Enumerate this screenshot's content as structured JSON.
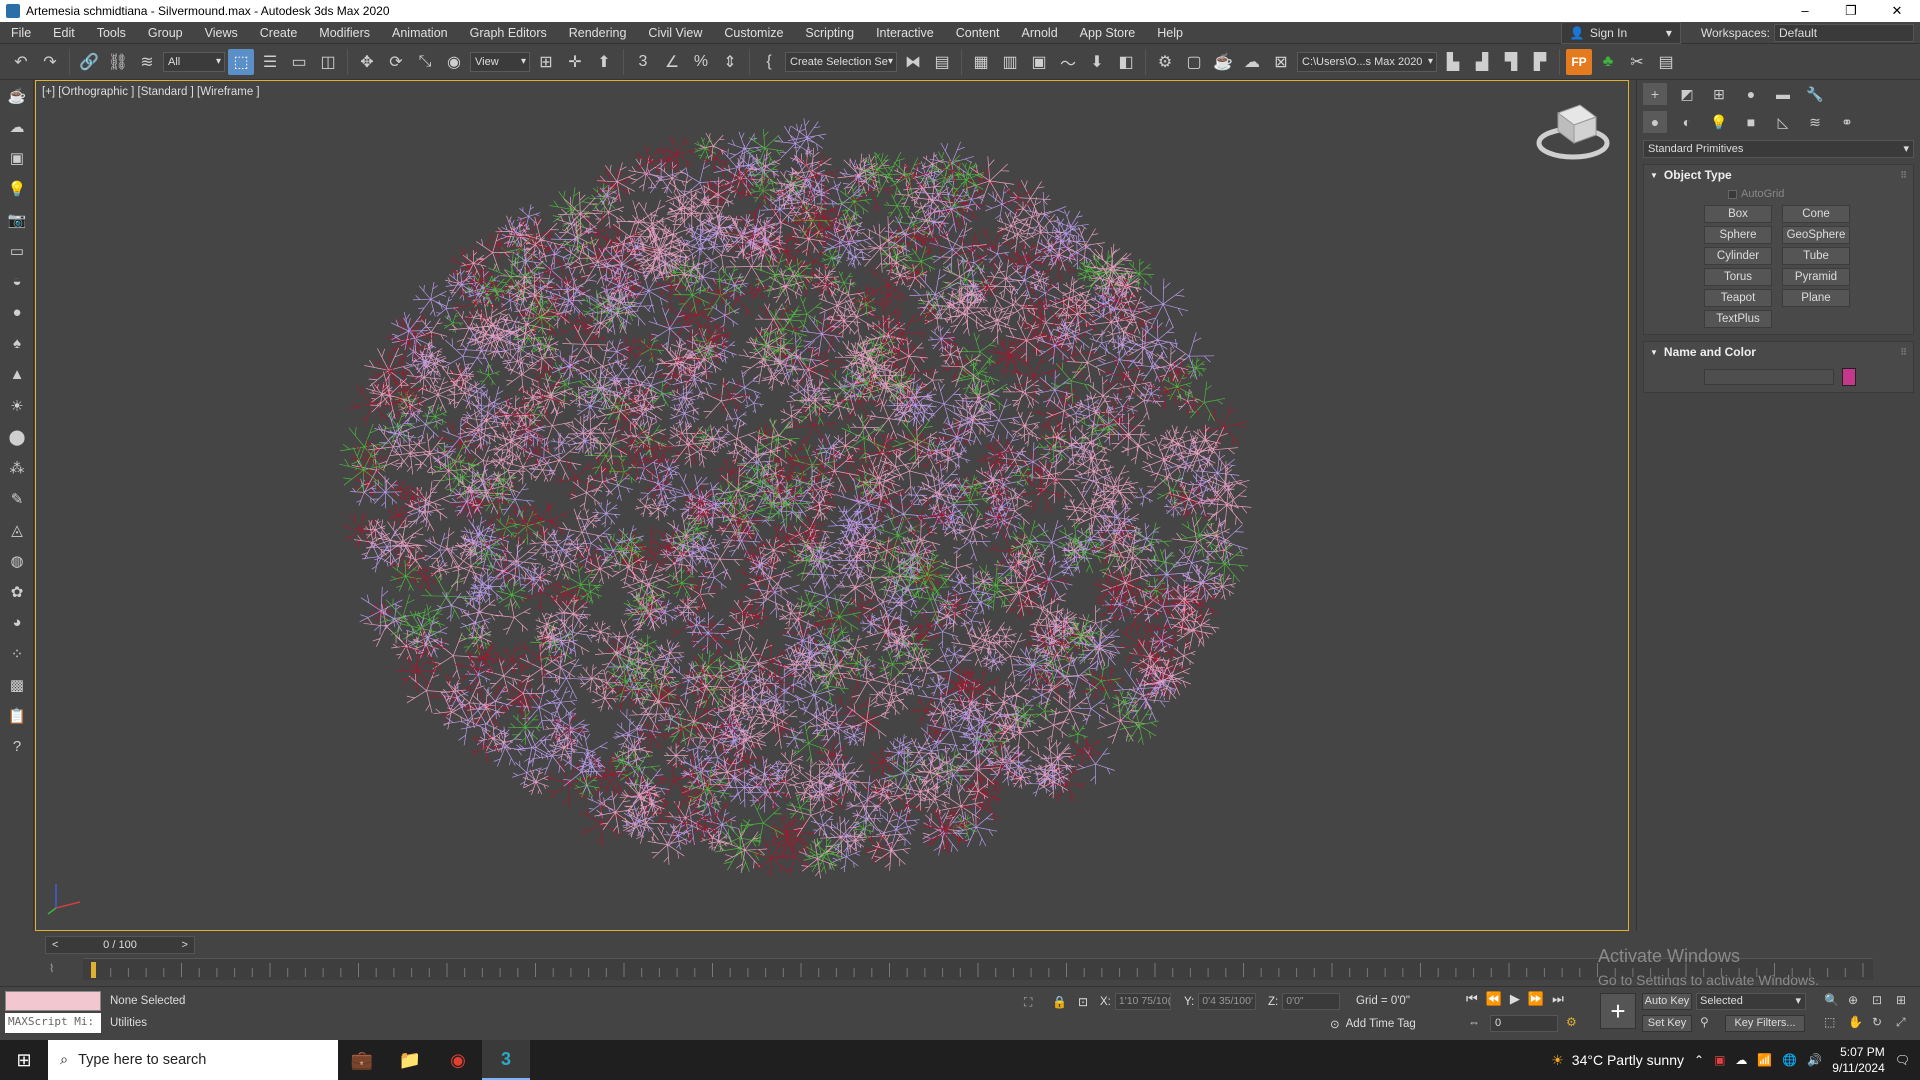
{
  "title_bar": {
    "title": "Artemesia schmidtiana - Silvermound.max - Autodesk 3ds Max 2020",
    "minimize": "–",
    "restore": "❐",
    "close": "✕"
  },
  "menu": {
    "items": [
      "File",
      "Edit",
      "Tools",
      "Group",
      "Views",
      "Create",
      "Modifiers",
      "Animation",
      "Graph Editors",
      "Rendering",
      "Civil View",
      "Customize",
      "Scripting",
      "Interactive",
      "Content",
      "Arnold",
      "App Store",
      "Help"
    ],
    "sign_in": "Sign In",
    "workspaces_label": "Workspaces:",
    "workspace_value": "Default"
  },
  "toolbar": {
    "filter_value": "All",
    "view_value": "View",
    "selection_set": "Create Selection Se",
    "project_path": "C:\\Users\\O...s Max 2020"
  },
  "viewport": {
    "label": "[+] [Orthographic ] [Standard ] [Wireframe ]",
    "background": "#454545",
    "wire_colors": [
      "#e8a0c0",
      "#b99bea",
      "#a0182e",
      "#4fb640"
    ]
  },
  "command_panel": {
    "category": "Standard Primitives",
    "object_type_title": "Object Type",
    "autogrid_label": "AutoGrid",
    "primitives": [
      "Box",
      "Cone",
      "Sphere",
      "GeoSphere",
      "Cylinder",
      "Tube",
      "Torus",
      "Pyramid",
      "Teapot",
      "Plane",
      "TextPlus"
    ],
    "name_color_title": "Name and Color",
    "object_color": "#c4378a"
  },
  "timeline": {
    "frame_display": "0 / 100",
    "prev": "<",
    "next": ">"
  },
  "status": {
    "maxscript_placeholder": "MAXScript Mi:",
    "selection_info": "None Selected",
    "utilities": "Utilities",
    "x_label": "X:",
    "x_value": "1'10 75/10(",
    "y_label": "Y:",
    "y_value": "0'4 35/100'",
    "z_label": "Z:",
    "z_value": "0'0\"",
    "grid": "Grid = 0'0\"",
    "add_time_tag": "Add Time Tag",
    "auto_key": "Auto Key",
    "set_key": "Set Key",
    "selected_value": "Selected",
    "key_filters": "Key Filters...",
    "frame_value": "0"
  },
  "watermark": {
    "line1": "Activate Windows",
    "line2": "Go to Settings to activate Windows."
  },
  "taskbar": {
    "search_placeholder": "Type here to search",
    "weather": "34°C  Partly sunny",
    "time": "5:07 PM",
    "date": "9/11/2024"
  }
}
